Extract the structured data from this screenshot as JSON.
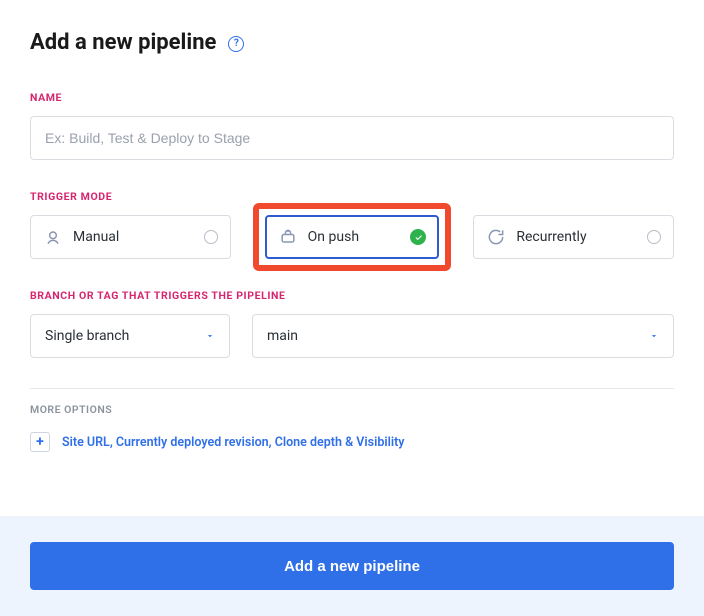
{
  "header": {
    "title": "Add a new pipeline"
  },
  "name_section": {
    "label": "NAME",
    "placeholder": "Ex: Build, Test & Deploy to Stage",
    "value": ""
  },
  "trigger_section": {
    "label": "TRIGGER MODE",
    "options": [
      {
        "label": "Manual",
        "selected": false
      },
      {
        "label": "On push",
        "selected": true
      },
      {
        "label": "Recurrently",
        "selected": false
      }
    ]
  },
  "branch_section": {
    "label": "BRANCH OR TAG THAT TRIGGERS THE PIPELINE",
    "scope_select": {
      "value": "Single branch"
    },
    "branch_select": {
      "value": "main"
    }
  },
  "more_options": {
    "label": "MORE OPTIONS",
    "link": "Site URL, Currently deployed revision, Clone depth & Visibility"
  },
  "footer": {
    "submit_label": "Add a new pipeline"
  }
}
